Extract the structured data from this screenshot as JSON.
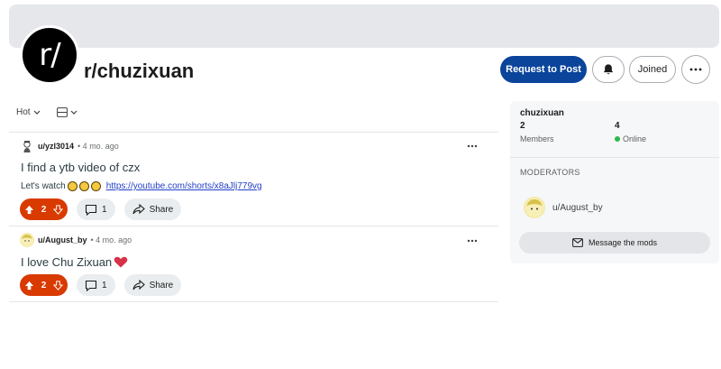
{
  "header": {
    "avatar_text": "r/",
    "subreddit": "r/chuzixuan",
    "request_label": "Request to Post",
    "joined_label": "Joined"
  },
  "sort": {
    "sort_label": "Hot"
  },
  "posts": [
    {
      "user": "u/yzl3014",
      "time": "• 4 mo. ago",
      "title": "I find a ytb video of czx",
      "body_text": "Let's watch",
      "link": "https://youtube.com/shorts/x8aJlj779vg",
      "votes": "2",
      "comments": "1",
      "share_label": "Share"
    },
    {
      "user": "u/August_by",
      "time": "• 4 mo. ago",
      "title": "I love Chu Zixuan",
      "votes": "2",
      "comments": "1",
      "share_label": "Share"
    }
  ],
  "sidebar": {
    "name": "chuzixuan",
    "members_count": "2",
    "members_label": "Members",
    "online_count": "4",
    "online_label": "Online",
    "moderators_heading": "MODERATORS",
    "moderator": "u/August_by",
    "message_label": "Message the mods"
  },
  "colors": {
    "primary_button": "#0a449b",
    "upvote": "#d93a00",
    "online": "#2db84d",
    "link": "#2340c8"
  }
}
